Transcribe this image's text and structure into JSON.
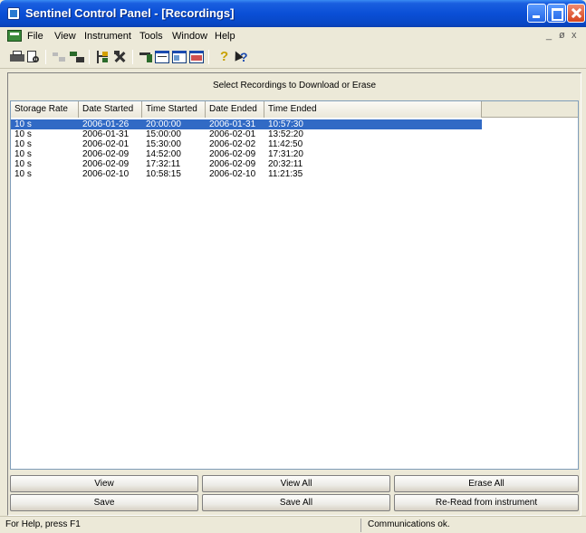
{
  "window": {
    "title": "Sentinel Control Panel - [Recordings]"
  },
  "menu": [
    "File",
    "View",
    "Instrument",
    "Tools",
    "Window",
    "Help"
  ],
  "mdi_controls": {
    "minimize": "_",
    "restore": "ø",
    "close": "x"
  },
  "toolbar": {
    "icons": [
      "print-icon",
      "print-preview-icon",
      "disconnect-icon",
      "connect-icon",
      "network-tree-icon",
      "tools-icon",
      "pin-tool-icon",
      "window-icon-1",
      "window-icon-2",
      "window-icon-3",
      "help-icon",
      "context-help-icon"
    ]
  },
  "panel": {
    "heading": "Select Recordings to Download or Erase"
  },
  "table": {
    "columns": [
      "Storage Rate",
      "Date Started",
      "Time Started",
      "Date Ended",
      "Time Ended"
    ],
    "rows": [
      [
        "10 s",
        "2006-01-26",
        "20:00:00",
        "2006-01-31",
        "10:57:30"
      ],
      [
        "10 s",
        "2006-01-31",
        "15:00:00",
        "2006-02-01",
        "13:52:20"
      ],
      [
        "10 s",
        "2006-02-01",
        "15:30:00",
        "2006-02-02",
        "11:42:50"
      ],
      [
        "10 s",
        "2006-02-09",
        "14:52:00",
        "2006-02-09",
        "17:31:20"
      ],
      [
        "10 s",
        "2006-02-09",
        "17:32:11",
        "2006-02-09",
        "20:32:11"
      ],
      [
        "10 s",
        "2006-02-10",
        "10:58:15",
        "2006-02-10",
        "11:21:35"
      ]
    ],
    "selected_row": 0
  },
  "buttons": {
    "view": "View",
    "view_all": "View All",
    "erase_all": "Erase All",
    "save": "Save",
    "save_all": "Save All",
    "reread": "Re-Read from instrument"
  },
  "status": {
    "help": "For Help, press F1",
    "comms": "Communications ok."
  },
  "colors": {
    "selection": "#316AC5",
    "titlebar": "#0A4FD6"
  }
}
